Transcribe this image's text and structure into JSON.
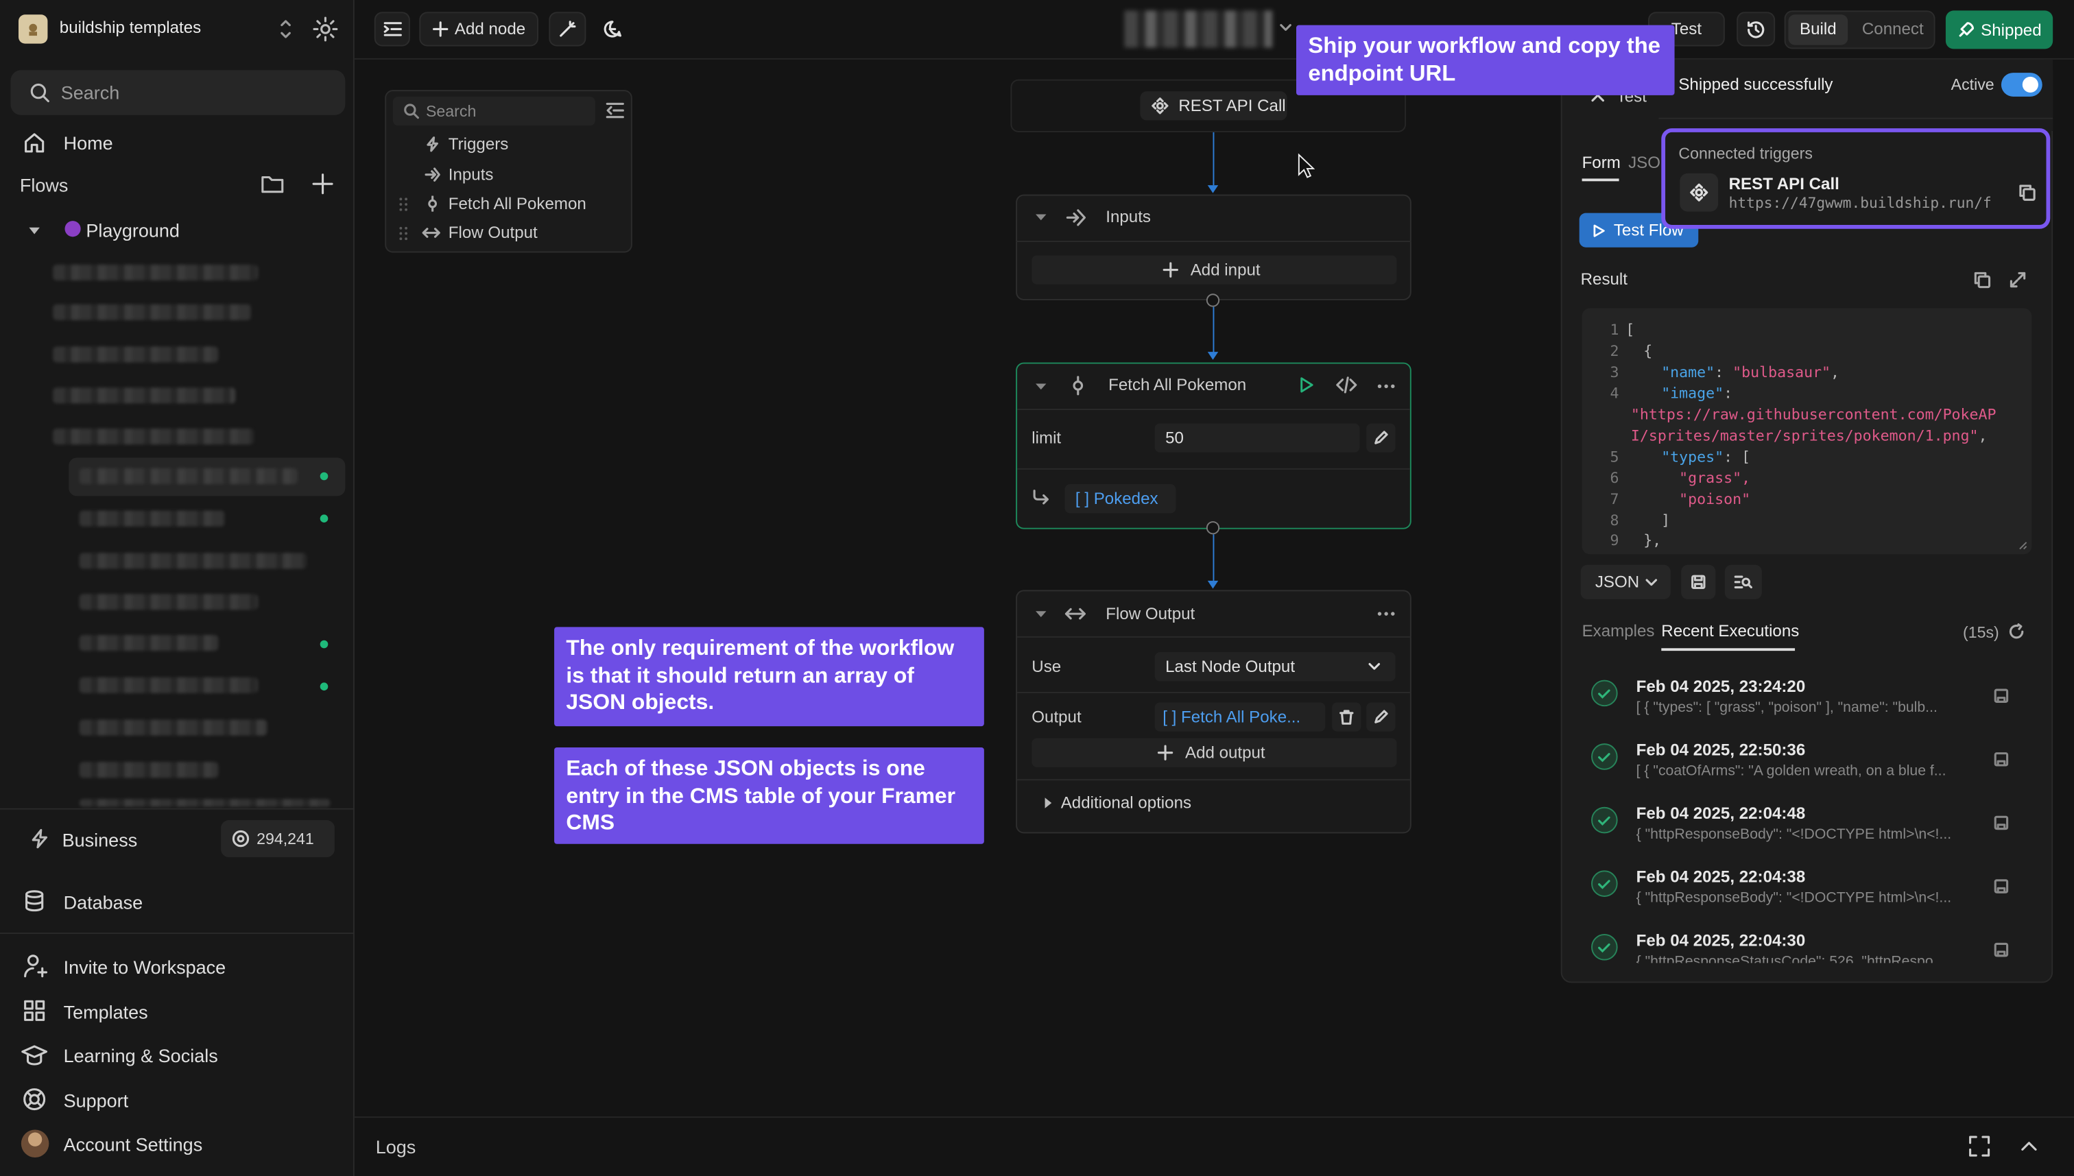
{
  "sidebar": {
    "workspace_name": "buildship templates",
    "search_placeholder": "Search",
    "home": "Home",
    "flows": "Flows",
    "playground": "Playground",
    "plan": "Business",
    "credits": "294,241",
    "database": "Database",
    "bottom": [
      "Invite to Workspace",
      "Templates",
      "Learning & Socials",
      "Support",
      "Account Settings"
    ]
  },
  "topbar": {
    "add_node": "Add node",
    "test": "Test",
    "build": "Build",
    "connect": "Connect",
    "shipped": "Shipped"
  },
  "outline": {
    "search_placeholder": "Search",
    "items": [
      "Triggers",
      "Inputs",
      "Fetch All Pokemon",
      "Flow Output"
    ]
  },
  "nodes": {
    "trigger": "REST API Call",
    "inputs": {
      "title": "Inputs",
      "add_input": "Add input"
    },
    "fetch": {
      "title": "Fetch All Pokemon",
      "limit_label": "limit",
      "limit_value": "50",
      "output_tag": "[ ] Pokedex"
    },
    "output": {
      "title": "Flow Output",
      "use_label": "Use",
      "use_value": "Last Node Output",
      "output_label": "Output",
      "output_value": "[ ]  Fetch All Poke...",
      "add_output": "Add output",
      "additional": "Additional options"
    }
  },
  "callouts": {
    "ship": "Ship your workflow and copy the endpoint URL",
    "requirement": "The only requirement of the workflow is that it should return an array of JSON objects.",
    "entry": "Each of these JSON objects is one entry in the CMS table of your Framer CMS"
  },
  "panel": {
    "close_label": "Test",
    "tab_form": "Form",
    "tab_json": "JSO",
    "test_flow": "Test Flow",
    "result": "Result",
    "format": "JSON",
    "tab_examples": "Examples",
    "tab_recent": "Recent Executions",
    "refresh_timer": "(15s)",
    "shipped_msg": "Shipped successfully",
    "active": "Active",
    "connected_triggers": "Connected triggers",
    "trigger_name": "REST API Call",
    "trigger_url": "https://47gwwm.buildship.run/f",
    "code_lines": [
      {
        "n": "1",
        "text": "["
      },
      {
        "n": "2",
        "text": "  {"
      },
      {
        "n": "3",
        "k": "\"name\"",
        "v": "\"bulbasaur\""
      },
      {
        "n": "4",
        "k": "\"image\"",
        "v": ""
      },
      {
        "n": "",
        "cont": "\"https://raw.githubusercontent.com/PokeAP"
      },
      {
        "n": "",
        "cont": "I/sprites/master/sprites/pokemon/1.png\""
      },
      {
        "n": "5",
        "k": "\"types\"",
        "v": "["
      },
      {
        "n": "6",
        "item": "\"grass\","
      },
      {
        "n": "7",
        "item": "\"poison\""
      },
      {
        "n": "8",
        "text": "    ]"
      },
      {
        "n": "9",
        "text": "  },"
      }
    ],
    "executions": [
      {
        "date": "Feb 04 2025, 23:24:20",
        "summary": "[ { \"types\": [ \"grass\", \"poison\" ], \"name\": \"bulb..."
      },
      {
        "date": "Feb 04 2025, 22:50:36",
        "summary": "[ { \"coatOfArms\": \"A golden wreath, on a blue f..."
      },
      {
        "date": "Feb 04 2025, 22:04:48",
        "summary": "{ \"httpResponseBody\": \"<!DOCTYPE html>\\n<!..."
      },
      {
        "date": "Feb 04 2025, 22:04:38",
        "summary": "{ \"httpResponseBody\": \"<!DOCTYPE html>\\n<!..."
      },
      {
        "date": "Feb 04 2025, 22:04:30",
        "summary": "{ \"httpResponseStatusCode\": 526, \"httpRespo..."
      }
    ]
  },
  "logs": "Logs",
  "colors": {
    "accent_purple": "#6e4ee5",
    "shipped_green": "#157f55",
    "link_blue": "#3a8ee6",
    "json_string": "#e05a8a"
  }
}
